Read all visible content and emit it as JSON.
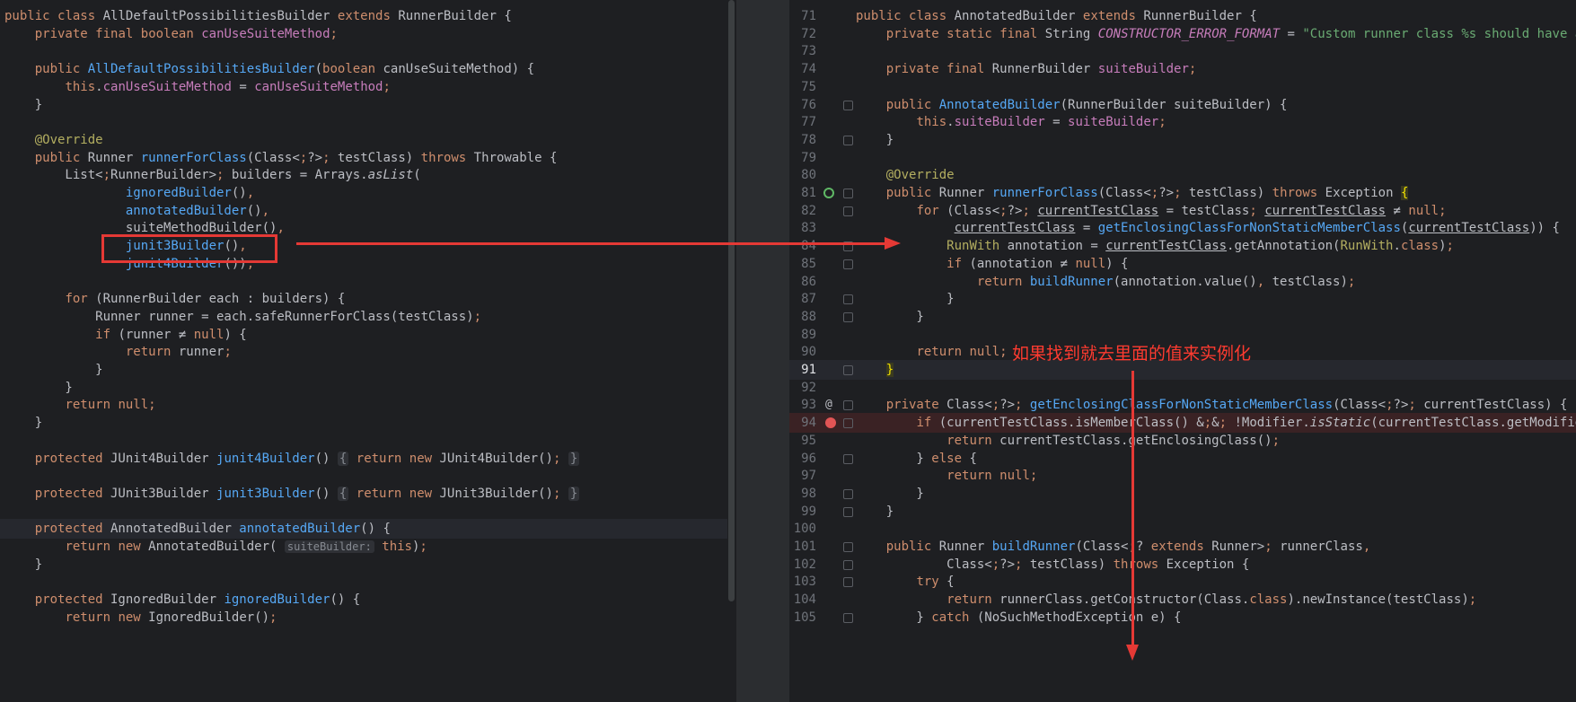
{
  "left_editor": {
    "lines": [
      "public class AllDefaultPossibilitiesBuilder extends RunnerBuilder {",
      "    private final boolean canUseSuiteMethod;",
      "",
      "    public AllDefaultPossibilitiesBuilder(boolean canUseSuiteMethod) {",
      "        this.canUseSuiteMethod = canUseSuiteMethod;",
      "    }",
      "",
      "    @Override",
      "    public Runner runnerForClass(Class<?> testClass) throws Throwable {",
      "        List<RunnerBuilder> builders = Arrays.asList(",
      "                ignoredBuilder(),",
      "                annotatedBuilder(),",
      "                suiteMethodBuilder(),",
      "                junit3Builder(),",
      "                junit4Builder());",
      "",
      "        for (RunnerBuilder each : builders) {",
      "            Runner runner = each.safeRunnerForClass(testClass);",
      "            if (runner ≠ null) {",
      "                return runner;",
      "            }",
      "        }",
      "        return null;",
      "    }",
      "",
      "    protected JUnit4Builder junit4Builder() { return new JUnit4Builder(); }",
      "",
      "    protected JUnit3Builder junit3Builder() { return new JUnit3Builder(); }",
      "",
      "    protected AnnotatedBuilder annotatedBuilder() {",
      "        return new AnnotatedBuilder( suiteBuilder: this);",
      "    }",
      "",
      "    protected IgnoredBuilder ignoredBuilder() {",
      "        return new IgnoredBuilder();"
    ]
  },
  "right_editor": {
    "line_numbers": [
      "71",
      "72",
      "73",
      "74",
      "75",
      "76",
      "77",
      "78",
      "79",
      "80",
      "81",
      "82",
      "83",
      "84",
      "85",
      "86",
      "87",
      "88",
      "89",
      "90",
      "91",
      "92",
      "93",
      "94",
      "95",
      "96",
      "97",
      "98",
      "99",
      "100",
      "101",
      "102",
      "103",
      "104",
      "105"
    ],
    "current_line": "91",
    "lines": [
      "public class AnnotatedBuilder extends RunnerBuilder {",
      "    private static final String CONSTRUCTOR_ERROR_FORMAT = \"Custom runner class %s should have a publ",
      "",
      "    private final RunnerBuilder suiteBuilder;",
      "",
      "    public AnnotatedBuilder(RunnerBuilder suiteBuilder) {",
      "        this.suiteBuilder = suiteBuilder;",
      "    }",
      "",
      "    @Override",
      "    public Runner runnerForClass(Class<?> testClass) throws Exception {",
      "        for (Class<?> currentTestClass = testClass; currentTestClass ≠ null;",
      "             currentTestClass = getEnclosingClassForNonStaticMemberClass(currentTestClass)) {",
      "            RunWith annotation = currentTestClass.getAnnotation(RunWith.class);",
      "            if (annotation ≠ null) {",
      "                return buildRunner(annotation.value(), testClass);",
      "            }",
      "        }",
      "",
      "        return null;",
      "    }",
      "",
      "    private Class<?> getEnclosingClassForNonStaticMemberClass(Class<?> currentTestClass) {",
      "        if (currentTestClass.isMemberClass() && !Modifier.isStatic(currentTestClass.getModifiers()))",
      "            return currentTestClass.getEnclosingClass();",
      "        } else {",
      "            return null;",
      "        }",
      "    }",
      "",
      "    public Runner buildRunner(Class<? extends Runner> runnerClass,",
      "            Class<?> testClass) throws Exception {",
      "        try {",
      "            return runnerClass.getConstructor(Class.class).newInstance(testClass);",
      "        } catch (NoSuchMethodException e) {"
    ]
  },
  "annotation": {
    "text": "如果找到就去里面的值来实例化",
    "color": "#ff3b30"
  },
  "colors": {
    "background": "#1e1f22",
    "keyword": "#cf8e6d",
    "function": "#56a8f5",
    "field": "#c77dbb",
    "string": "#6aab73",
    "annotation_kw": "#b3ae60",
    "arrow": "#e53935"
  }
}
